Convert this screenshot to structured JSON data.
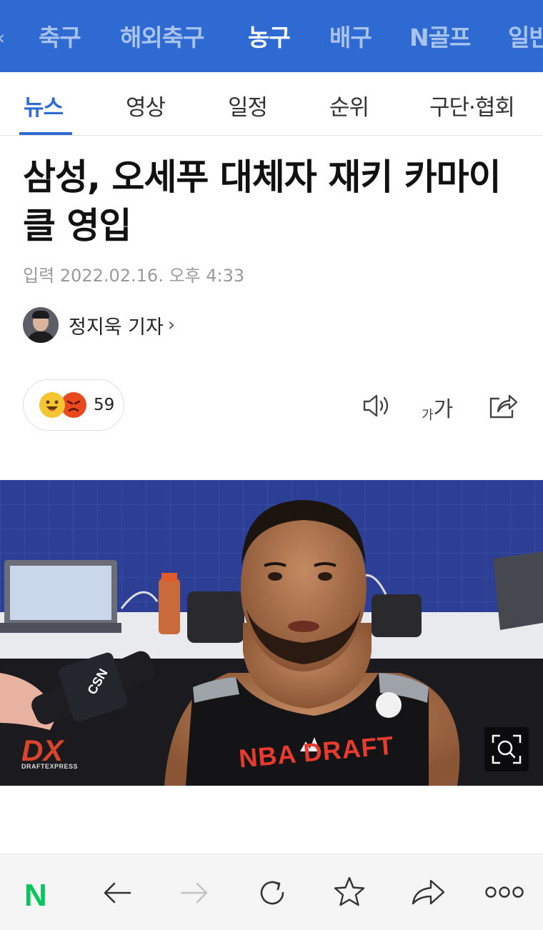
{
  "sport_nav": {
    "items": [
      "축구",
      "해외축구",
      "농구",
      "배구",
      "N골프",
      "일반"
    ],
    "active_index": 2
  },
  "sub_tabs": {
    "items": [
      "뉴스",
      "영상",
      "일정",
      "순위",
      "구단·협회"
    ],
    "active_index": 0
  },
  "article": {
    "title": "삼성, 오세푸 대체자 재키 카마이클 영입",
    "date": "입력 2022.02.16. 오후 4:33",
    "author": "정지욱 기자"
  },
  "reactions": {
    "count": "59"
  },
  "toolbar": {
    "font_size_label_small": "가",
    "font_size_label_large": "가"
  },
  "photo": {
    "shirt_text": "NBA DRAFT",
    "logo_text": "DX",
    "logo_sub": "DRAFTEXPRESS",
    "mic_text": "CSN"
  },
  "bottom_bar": {
    "logo": "N"
  },
  "colors": {
    "brand_blue": "#2f6ad3",
    "naver_green": "#03c75a"
  }
}
